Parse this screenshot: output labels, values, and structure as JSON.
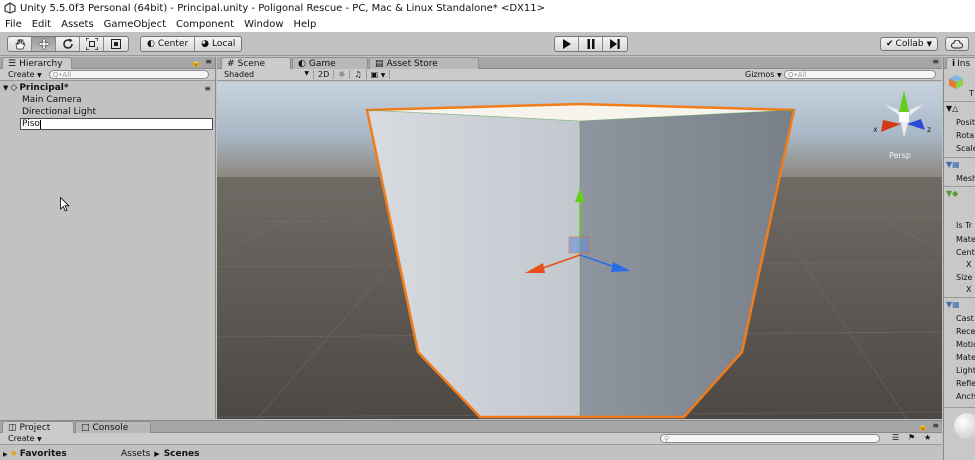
{
  "title": "Unity 5.5.0f3 Personal (64bit) - Principal.unity - Poligonal Rescue - PC, Mac & Linux Standalone* <DX11>",
  "menu": [
    "File",
    "Edit",
    "Assets",
    "GameObject",
    "Component",
    "Window",
    "Help"
  ],
  "toolbar": {
    "tools": [
      "hand-tool-icon",
      "move-tool-icon",
      "rotate-tool-icon",
      "scale-tool-icon",
      "rect-tool-icon"
    ],
    "pivot_label": "Center",
    "space_label": "Local",
    "collab_label": "Collab",
    "accent": "#f07d1a"
  },
  "hierarchy": {
    "tab_label": "Hierarchy",
    "create_label": "Create",
    "search_placeholder": "Q•All",
    "scene_name": "Principal*",
    "items": [
      "Main Camera",
      "Directional Light"
    ],
    "rename_value": "Piso"
  },
  "scene": {
    "tabs": [
      "Scene",
      "Game",
      "Asset Store"
    ],
    "shading_mode": "Shaded",
    "mode_2d": "2D",
    "gizmos_label": "Gizmos",
    "search_placeholder": "Q•All",
    "persp_label": "Persp",
    "gizmo_axes": [
      "x",
      "z"
    ]
  },
  "inspector": {
    "tab_label": "Ins",
    "transform_rows": [
      "Posit",
      "Rota",
      "Scale"
    ],
    "mesh_label": "Mesh",
    "collider_rows": [
      "Is Tr",
      "Mate",
      "Cent",
      "X",
      "Size",
      "X"
    ],
    "renderer_rows": [
      "Cast",
      "Rece",
      "Motic",
      "Mate",
      "Light",
      "Refle",
      "Anch"
    ],
    "t_label": "T"
  },
  "project": {
    "tabs": [
      "Project",
      "Console"
    ],
    "create_label": "Create",
    "favorites_label": "Favorites",
    "breadcrumb_root": "Assets",
    "breadcrumb_current": "Scenes"
  }
}
